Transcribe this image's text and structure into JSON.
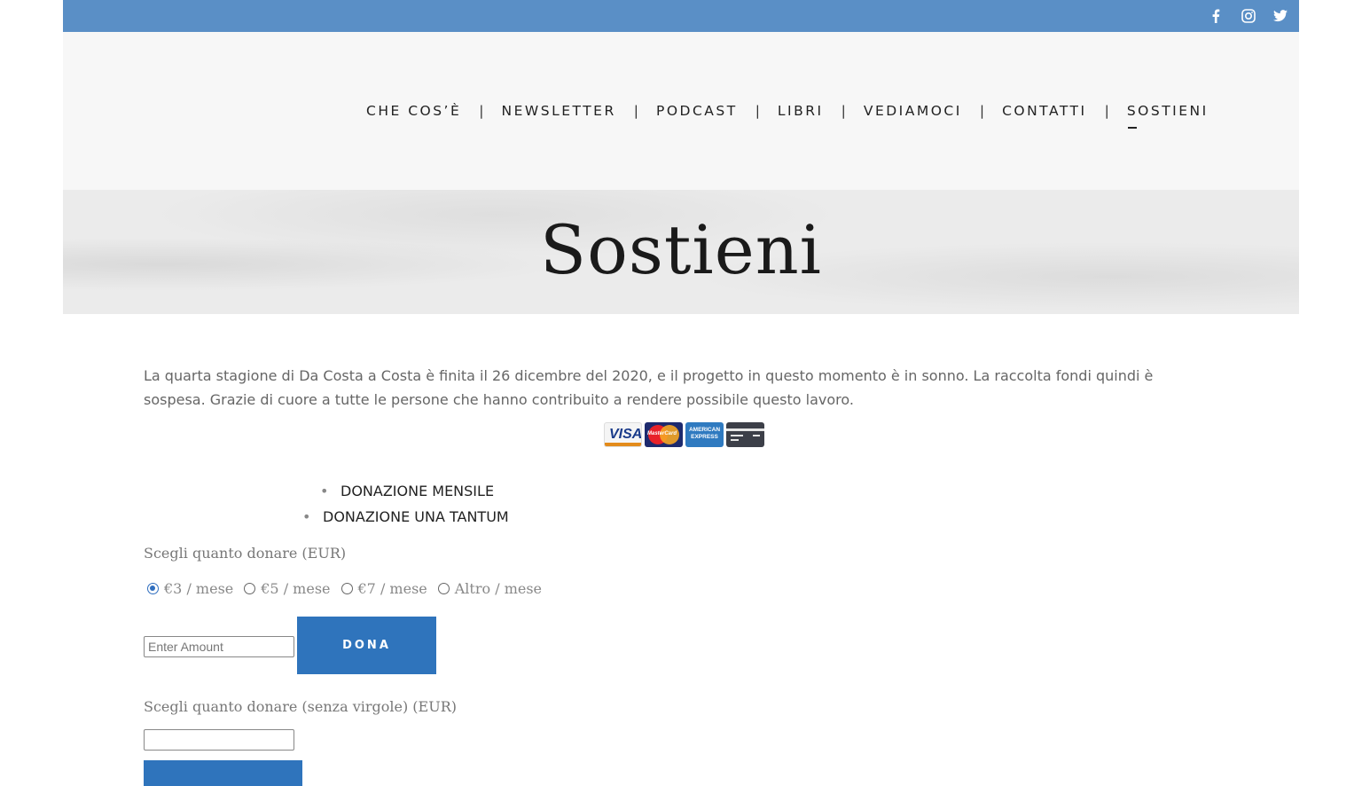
{
  "topbar": {
    "social": [
      "facebook-icon",
      "instagram-icon",
      "twitter-icon"
    ],
    "color": "#5a8fc6"
  },
  "nav": {
    "items": [
      "CHE COS’È",
      "NEWSLETTER",
      "PODCAST",
      "LIBRI",
      "VEDIAMOCI",
      "CONTATTI",
      "SOSTIENI"
    ],
    "separator": "|",
    "active": "SOSTIENI"
  },
  "hero": {
    "title": "Sostieni"
  },
  "intro": {
    "line1": "La quarta stagione di Da Costa a Costa è finita il 26 dicembre del 2020, e il progetto in questo momento è in sonno. La raccolta fondi quindi è",
    "line2": "sospesa. Grazie di cuore a tutte le persone che hanno contribuito a rendere possibile questo lavoro."
  },
  "cards": {
    "visa": "VISA",
    "mastercard": "MasterCard",
    "amex": "AMERICAN EXPRESS"
  },
  "donation_types": [
    "DONAZIONE MENSILE",
    "DONAZIONE UNA TANTUM"
  ],
  "form1": {
    "label": "Scegli quanto donare (EUR)",
    "options": [
      "€3 / mese",
      "€5 / mese",
      "€7 / mese",
      "Altro / mese"
    ],
    "selected": "€3 / mese",
    "amount_placeholder": "Enter Amount",
    "button": "DONA"
  },
  "form2": {
    "label": "Scegli quanto donare (senza virgole) (EUR)"
  },
  "colors": {
    "accent": "#2f74bc"
  }
}
